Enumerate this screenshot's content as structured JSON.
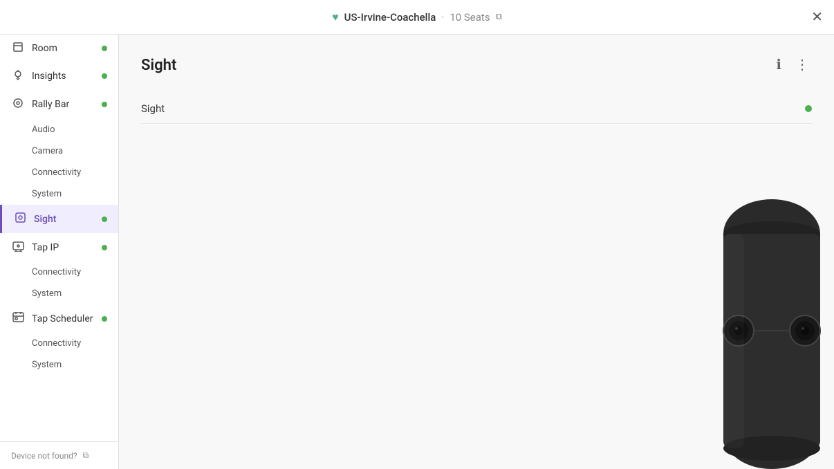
{
  "topbar": {
    "title": "US-Irvine-Coachella",
    "separator": "·",
    "seats": "10 Seats",
    "close_label": "✕"
  },
  "sidebar": {
    "items": [
      {
        "id": "room",
        "label": "Room",
        "icon": "⊡",
        "status": "green",
        "active": false
      },
      {
        "id": "insights",
        "label": "Insights",
        "icon": "💡",
        "status": "green",
        "active": false
      },
      {
        "id": "rally-bar",
        "label": "Rally Bar",
        "icon": "◎",
        "status": "green",
        "active": false
      }
    ],
    "rallybar_sub": [
      {
        "id": "audio",
        "label": "Audio"
      },
      {
        "id": "camera",
        "label": "Camera"
      },
      {
        "id": "connectivity-rb",
        "label": "Connectivity"
      },
      {
        "id": "system-rb",
        "label": "System"
      }
    ],
    "sight": {
      "id": "sight",
      "label": "Sight",
      "icon": "⬛",
      "status": "green",
      "active": true
    },
    "tap_ip": {
      "id": "tap-ip",
      "label": "Tap IP",
      "icon": "⬜",
      "status": "green",
      "active": false
    },
    "tapip_sub": [
      {
        "id": "connectivity-tip",
        "label": "Connectivity"
      },
      {
        "id": "system-tip",
        "label": "System"
      }
    ],
    "tap_scheduler": {
      "id": "tap-scheduler",
      "label": "Tap Scheduler",
      "icon": "⬛",
      "status": "green",
      "active": false
    },
    "tapscheduler_sub": [
      {
        "id": "connectivity-ts",
        "label": "Connectivity"
      },
      {
        "id": "system-ts",
        "label": "System"
      }
    ],
    "footer": {
      "label": "Device not found?",
      "link_icon": "⧉"
    }
  },
  "content": {
    "title": "Sight",
    "info_label": "ℹ",
    "more_label": "⋮",
    "sight_row_label": "Sight",
    "sight_row_status": "green"
  }
}
